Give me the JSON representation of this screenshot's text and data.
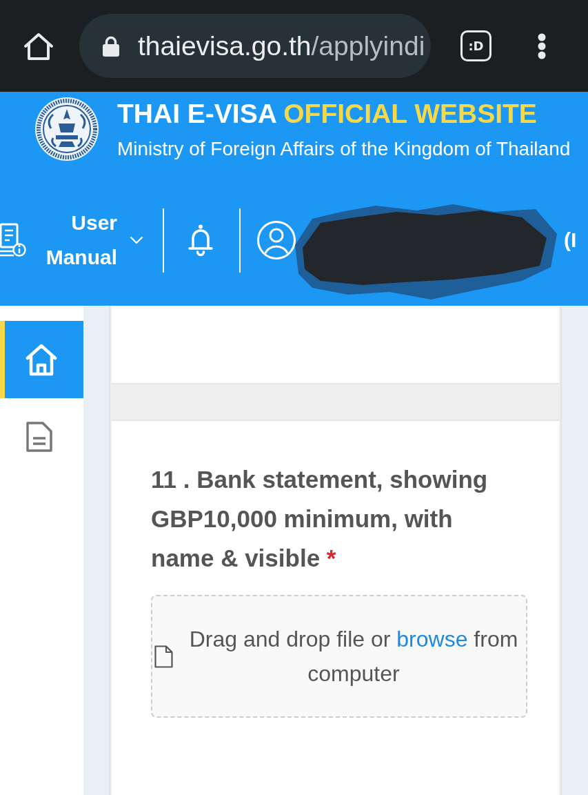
{
  "browser": {
    "url_host": "thaievisa.go.th",
    "url_path": "/applyindi",
    "tab_switcher": ":D"
  },
  "header": {
    "title": "THAI E-VISA",
    "title_highlight": "OFFICIAL WEBSITE",
    "subtitle": "Ministry of Foreign Affairs of the Kingdom of Thailand"
  },
  "nav": {
    "user_manual": "User Manual",
    "account_label": "(I"
  },
  "sidebar": {
    "items": [
      {
        "kind": "home",
        "selected": true
      },
      {
        "kind": "document",
        "selected": false
      }
    ]
  },
  "question": {
    "label": "11 . Bank statement, showing GBP10,000 minimum, with name & visible",
    "required_mark": "*",
    "upload": {
      "text": "Drag and drop file or",
      "link": "browse",
      "text_end": "from computer"
    }
  }
}
